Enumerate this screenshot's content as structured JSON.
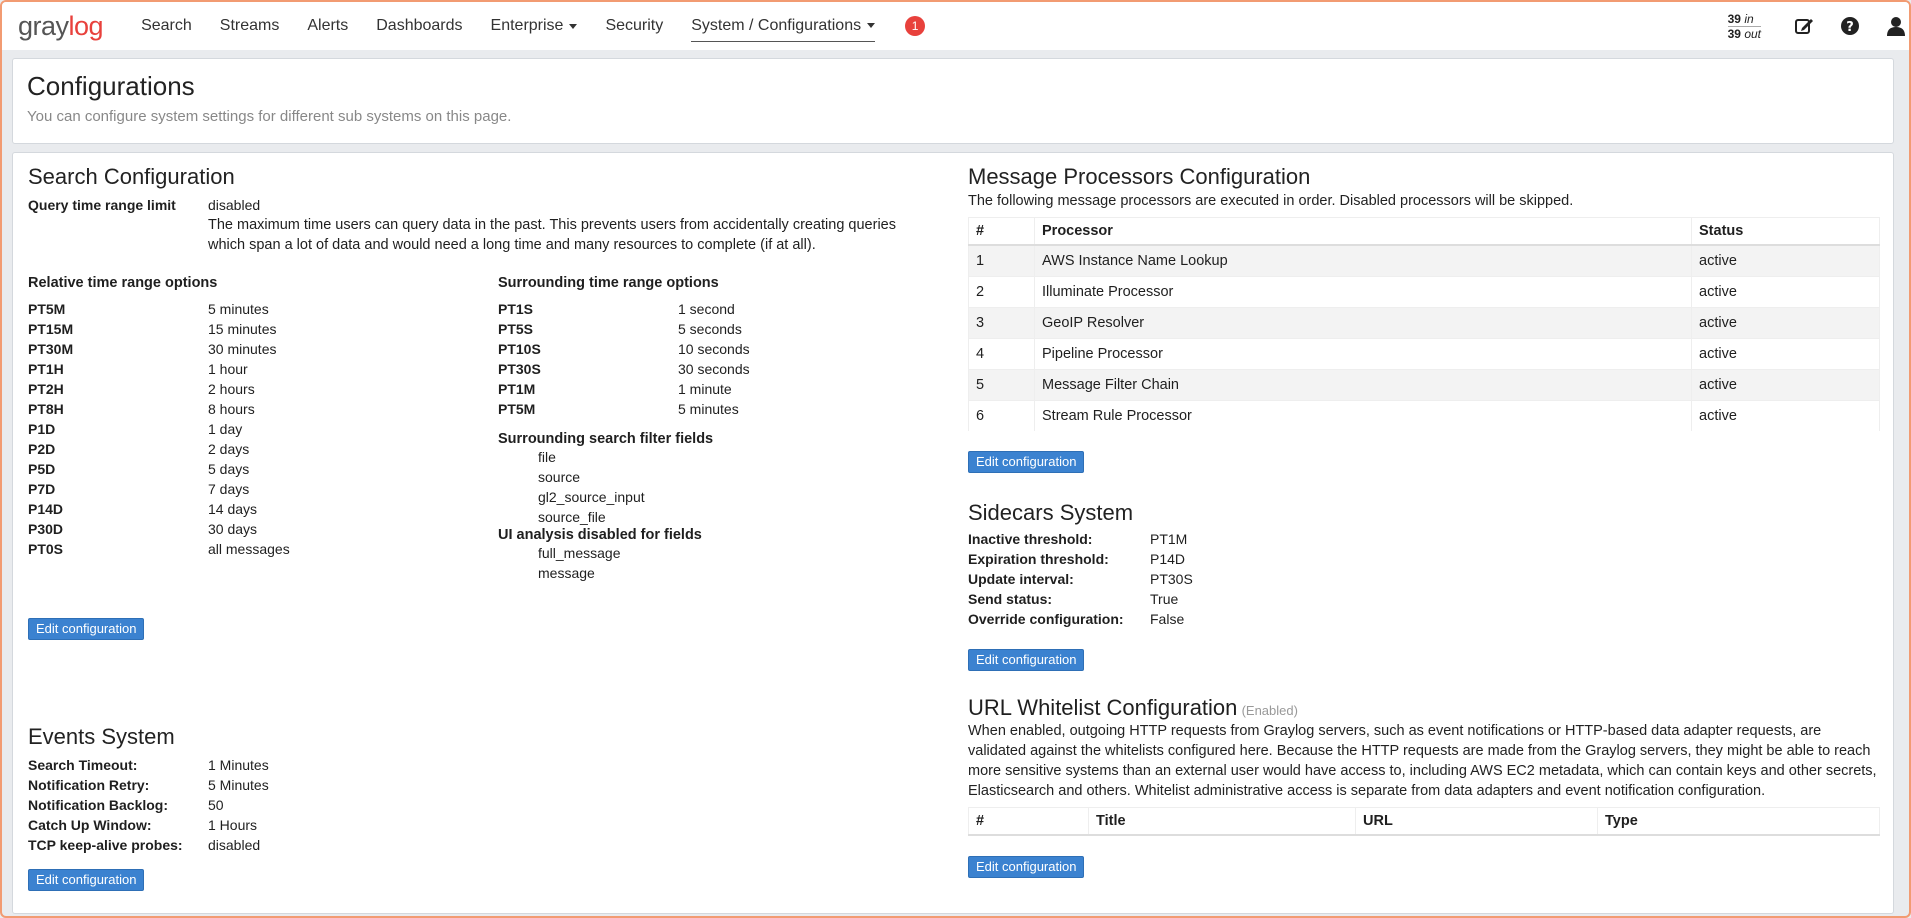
{
  "nav": {
    "brand_a": "gray",
    "brand_b": "log",
    "items": [
      "Search",
      "Streams",
      "Alerts",
      "Dashboards",
      "Enterprise",
      "Security",
      "System / Configurations"
    ],
    "notification_count": "1",
    "throughput_in_num": "39",
    "throughput_in_unit": "in",
    "throughput_out_num": "39",
    "throughput_out_unit": "out",
    "icons": [
      "edit-icon",
      "help-icon",
      "user-icon"
    ]
  },
  "header": {
    "title": "Configurations",
    "description": "You can configure system settings for different sub systems on this page."
  },
  "search_config": {
    "title": "Search Configuration",
    "query_limit_label": "Query time range limit",
    "query_limit_value": "disabled",
    "query_limit_desc": "The maximum time users can query data in the past. This prevents users from accidentally creating queries which span a lot of data and would need a long time and many resources to complete (if at all).",
    "relative_title": "Relative time range options",
    "relative": [
      [
        "PT5M",
        "5 minutes"
      ],
      [
        "PT15M",
        "15 minutes"
      ],
      [
        "PT30M",
        "30 minutes"
      ],
      [
        "PT1H",
        "1 hour"
      ],
      [
        "PT2H",
        "2 hours"
      ],
      [
        "PT8H",
        "8 hours"
      ],
      [
        "P1D",
        "1 day"
      ],
      [
        "P2D",
        "2 days"
      ],
      [
        "P5D",
        "5 days"
      ],
      [
        "P7D",
        "7 days"
      ],
      [
        "P14D",
        "14 days"
      ],
      [
        "P30D",
        "30 days"
      ],
      [
        "PT0S",
        "all messages"
      ]
    ],
    "surrounding_title": "Surrounding time range options",
    "surrounding": [
      [
        "PT1S",
        "1 second"
      ],
      [
        "PT5S",
        "5 seconds"
      ],
      [
        "PT10S",
        "10 seconds"
      ],
      [
        "PT30S",
        "30 seconds"
      ],
      [
        "PT1M",
        "1 minute"
      ],
      [
        "PT5M",
        "5 minutes"
      ]
    ],
    "filter_fields_title": "Surrounding search filter fields",
    "filter_fields": [
      "file",
      "source",
      "gl2_source_input",
      "source_file"
    ],
    "ui_disabled_title": "UI analysis disabled for fields",
    "ui_disabled": [
      "full_message",
      "message"
    ],
    "edit_label": "Edit configuration"
  },
  "events": {
    "title": "Events System",
    "rows": [
      [
        "Search Timeout:",
        "1 Minutes"
      ],
      [
        "Notification Retry:",
        "5 Minutes"
      ],
      [
        "Notification Backlog:",
        "50"
      ],
      [
        "Catch Up Window:",
        "1 Hours"
      ],
      [
        "TCP keep-alive probes:",
        "disabled"
      ]
    ],
    "edit_label": "Edit configuration"
  },
  "processors": {
    "title": "Message Processors Configuration",
    "desc": "The following message processors are executed in order. Disabled processors will be skipped.",
    "columns": [
      "#",
      "Processor",
      "Status"
    ],
    "rows": [
      [
        "1",
        "AWS Instance Name Lookup",
        "active"
      ],
      [
        "2",
        "Illuminate Processor",
        "active"
      ],
      [
        "3",
        "GeoIP Resolver",
        "active"
      ],
      [
        "4",
        "Pipeline Processor",
        "active"
      ],
      [
        "5",
        "Message Filter Chain",
        "active"
      ],
      [
        "6",
        "Stream Rule Processor",
        "active"
      ]
    ],
    "edit_label": "Edit configuration"
  },
  "sidecars": {
    "title": "Sidecars System",
    "rows": [
      [
        "Inactive threshold:",
        "PT1M"
      ],
      [
        "Expiration threshold:",
        "P14D"
      ],
      [
        "Update interval:",
        "PT30S"
      ],
      [
        "Send status:",
        "True"
      ],
      [
        "Override configuration:",
        "False"
      ]
    ],
    "edit_label": "Edit configuration"
  },
  "whitelist": {
    "title": "URL Whitelist Configuration",
    "status": "(Enabled)",
    "desc": "When enabled, outgoing HTTP requests from Graylog servers, such as event notifications or HTTP-based data adapter requests, are validated against the whitelists configured here. Because the HTTP requests are made from the Graylog servers, they might be able to reach more sensitive systems than an external user would have access to, including AWS EC2 metadata, which can contain keys and other secrets, Elasticsearch and others. Whitelist administrative access is separate from data adapters and event notification configuration.",
    "columns": [
      "#",
      "Title",
      "URL",
      "Type"
    ],
    "edit_label": "Edit configuration"
  }
}
